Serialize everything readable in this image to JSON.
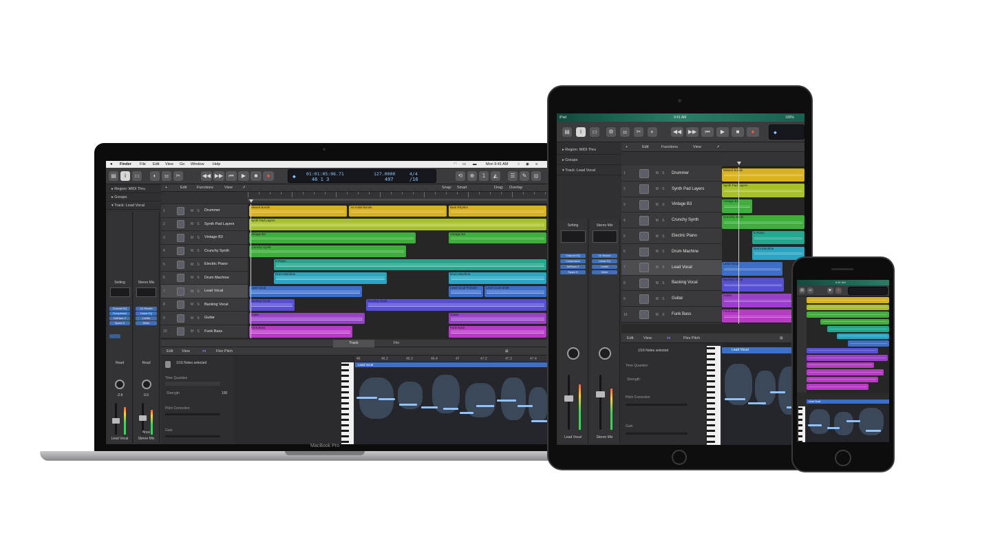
{
  "colors": {
    "yellow": "#d9b21f",
    "lime": "#a7c02b",
    "green": "#3fae3c",
    "teal": "#23a88f",
    "cyan": "#2aa6c2",
    "blue": "#3e6fc8",
    "indigo": "#5850d4",
    "purple": "#9a3fc8",
    "magenta": "#b83ac7"
  },
  "macbook": {
    "brand": "MacBook Pro",
    "menubar": {
      "apple": "",
      "items": [
        "Finder",
        "File",
        "Edit",
        "View",
        "Go",
        "Window",
        "Help"
      ],
      "clock": "Mon 9:41 AM"
    },
    "lcd": {
      "time": "01:01:05:06.71",
      "bars": "46  1  3",
      "tempo": "127.0000",
      "tempo2": "497",
      "signature": "4/4",
      "division": "/16"
    },
    "panel_rows": [
      "Region: MIDI Thru",
      "Groups",
      "Track: Lead Vocal"
    ],
    "toolbar_menu": [
      "Edit",
      "Functions",
      "View"
    ],
    "snap_label": "Snap:",
    "snap_value": "Smart",
    "drag_label": "Drag:",
    "drag_value": "Overlap",
    "tracks": [
      "Drummer",
      "Synth Pad Layers",
      "Vintage B3",
      "Crunchy Synth",
      "Electric Piano",
      "Drum Machine",
      "Lead Vocal",
      "Backing Vocal",
      "Guitar",
      "Funk Bass"
    ],
    "regions": [
      "Missed Bonds",
      "Art Initial Bonds",
      "Beat Rhythm",
      "Synth Pad Layers",
      "Vintage B3",
      "Vintage B3",
      "Crunchy Synth",
      "E Piano",
      "Drum Machine",
      "Drum Machine",
      "Lead Vocal",
      "Lead Vocal Prelude",
      "Lead Vocal Bride",
      "Backing Vocal",
      "Backing Vocal",
      "Guitar",
      "Guitar",
      "Funk Bass",
      "Funk Bass"
    ],
    "mixer": {
      "strip1_name": "Lead Vocal",
      "strip2_name": "Stereo Mix",
      "strip1_top": "Setting",
      "strip2_top": "Stereo Mix",
      "plugins1": [
        "Channel EQ",
        "Compressor",
        "DeEsser 2",
        "Space D"
      ],
      "plugins2": [
        "Ch Reverb",
        "Linear EQ",
        "Limiter",
        "Meter"
      ],
      "read": "Read",
      "value1": "-2.8",
      "value2": "0.0",
      "bounce": "Bnce"
    },
    "editor": {
      "tabs": [
        "Track",
        "File"
      ],
      "menu": [
        "Edit",
        "View"
      ],
      "mode": "Flex Pitch",
      "region_name": "Lead Vocal",
      "inspector_title": "1/16 Notes selected",
      "inspector_labels": [
        "Time Quantize",
        "Strength",
        "Pitch Correction",
        "Gain"
      ],
      "strength_value": "100",
      "ruler_labels": [
        "46",
        "46.2",
        "46.3",
        "46.4",
        "47",
        "47.2",
        "47.3",
        "47.4"
      ]
    }
  },
  "ipad": {
    "status": {
      "left": "iPad",
      "time": "9:41 AM",
      "right": "100%"
    },
    "panel_rows": [
      "Region: MIDI Thru",
      "Groups",
      "Track: Lead Vocal"
    ],
    "toolbar_menu": [
      "Edit",
      "Functions",
      "View"
    ],
    "tracks": [
      "Drummer",
      "Synth Pad Layers",
      "Vintage B3",
      "Crunchy Synth",
      "Electric Piano",
      "Drum Machine",
      "Lead Vocal",
      "Backing Vocal",
      "Guitar",
      "Funk Bass"
    ],
    "regions": [
      "Missed Bonds",
      "Synth Pad Layers",
      "Vintage B3",
      "Crunchy Synth",
      "E Piano",
      "Drum Machine",
      "Lead Vocal",
      "Backing Vocal",
      "Guitar",
      "Funk Bass"
    ],
    "mixer": {
      "strip1_top": "Setting",
      "strip2_top": "Stereo Mix",
      "plugins1": [
        "Channel EQ",
        "Compressor",
        "DeEsser 2",
        "Space D"
      ],
      "plugins2": [
        "Ch Reverb",
        "Linear EQ",
        "Limiter",
        "Meter"
      ],
      "strip1_name": "Lead Vocal",
      "strip2_name": "Stereo Mix"
    },
    "editor": {
      "menu": [
        "Edit",
        "View"
      ],
      "mode": "Flex Pitch",
      "region_name": "Lead Vocal",
      "inspector_title": "1/16 Notes selected",
      "inspector_labels": [
        "Time Quantize",
        "Strength",
        "Pitch Correction",
        "Gain"
      ]
    }
  },
  "iphone": {
    "status_time": "9:41 AM",
    "region_name": "Lead Vocal"
  }
}
